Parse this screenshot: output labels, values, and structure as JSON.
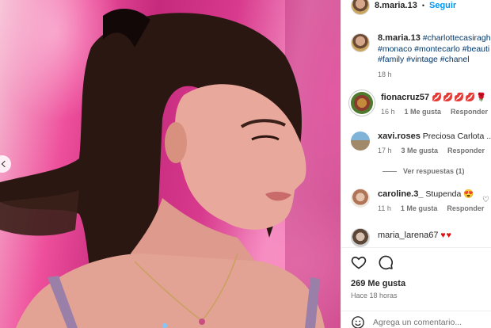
{
  "post": {
    "author": "8.maria.13",
    "follow_label": "Seguir",
    "separator": "•"
  },
  "caption": {
    "author": "8.maria.13",
    "line1": "#charlottecasiraghi",
    "line2": "#monaco #montecarlo #beauti",
    "line3": "#family #vintage #chanel",
    "time": "18 h"
  },
  "comments": [
    {
      "user": "fionacruz57",
      "text": "💋💋💋💋🌹",
      "time": "16 h",
      "likes": "1 Me gusta",
      "reply": "Responder"
    },
    {
      "user": "xavi.roses",
      "text": "Preciosa Carlota ..El v",
      "time": "17 h",
      "likes": "3 Me gusta",
      "reply": "Responder",
      "view_replies": "Ver respuestas (1)"
    },
    {
      "user": "caroline.3_",
      "text": "Stupenda 😍",
      "time": "11 h",
      "likes": "1 Me gusta",
      "reply": "Responder"
    },
    {
      "user": "maria_larena67",
      "text": "♥♥"
    }
  ],
  "footer": {
    "likes": "269 Me gusta",
    "posted": "Hace 18 horas",
    "comment_placeholder": "Agrega un comentario..."
  },
  "icons": {
    "like": "heart-icon",
    "comment": "comment-icon",
    "emoji": "emoji-icon",
    "comment_like": "heart-outline-icon",
    "prev": "chevron-left-icon"
  },
  "colors": {
    "link_blue": "#0095f6",
    "hashtag": "#00376b",
    "muted": "#737373"
  }
}
